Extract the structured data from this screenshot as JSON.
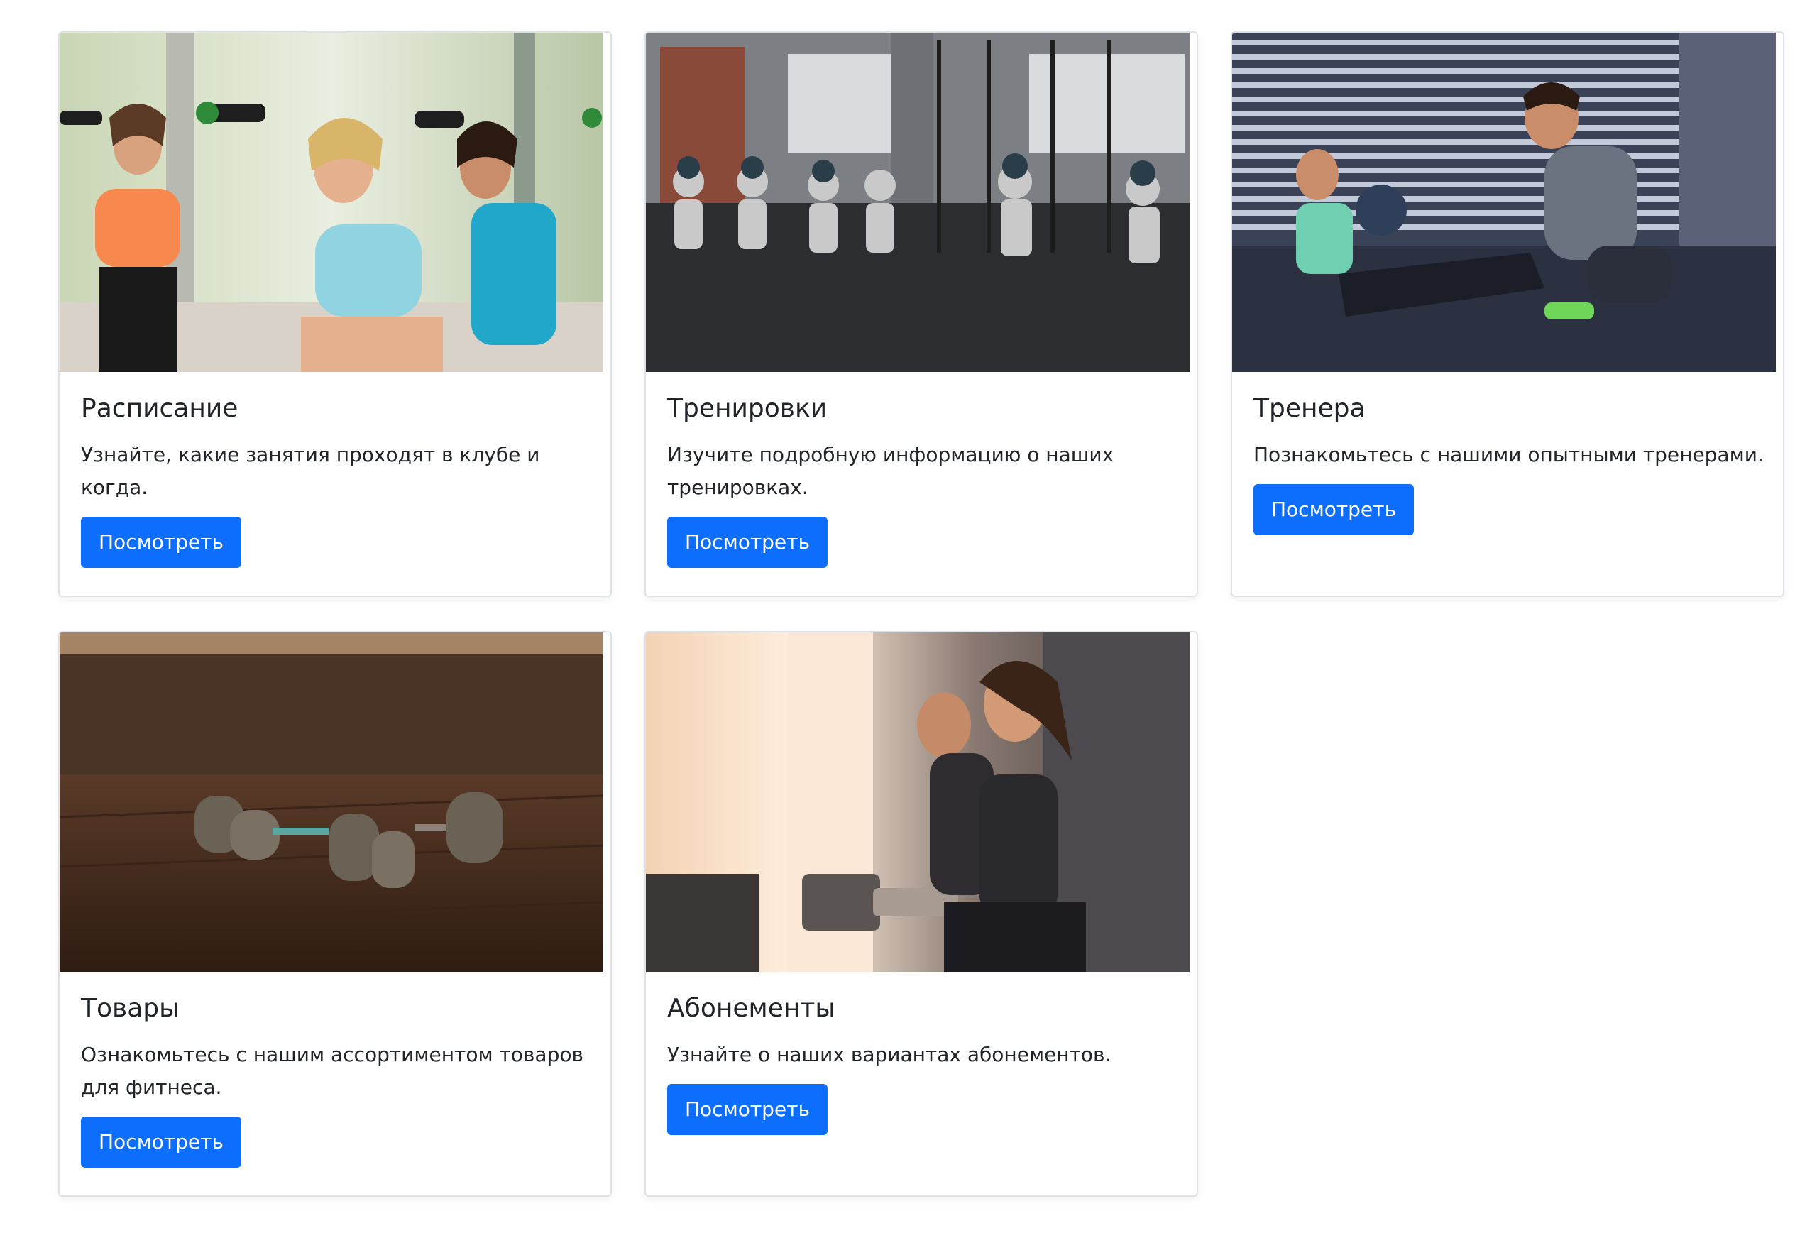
{
  "cards": [
    {
      "title": "Расписание",
      "text": "Узнайте, какие занятия проходят в клубе и когда.",
      "button": "Посмотреть",
      "image": "group-dumbbell-class-photo"
    },
    {
      "title": "Тренировки",
      "text": "Изучите подробную информацию о наших тренировках.",
      "button": "Посмотреть",
      "image": "gym-squat-with-medicine-ball-photo"
    },
    {
      "title": "Тренера",
      "text": "Познакомьтесь с нашими опытными тренерами.",
      "button": "Посмотреть",
      "image": "trainer-with-client-situps-photo"
    },
    {
      "title": "Товары",
      "text": "Ознакомьтесь с нашим ассортиментом товаров для фитнеса.",
      "button": "Посмотреть",
      "image": "dumbbells-on-floor-photo"
    },
    {
      "title": "Абонементы",
      "text": "Узнайте о наших вариантах абонементов.",
      "button": "Посмотреть",
      "image": "woman-on-treadmill-photo"
    }
  ],
  "colors": {
    "primary": "#0d6efd",
    "text": "#212529",
    "border": "#dee2e6"
  }
}
